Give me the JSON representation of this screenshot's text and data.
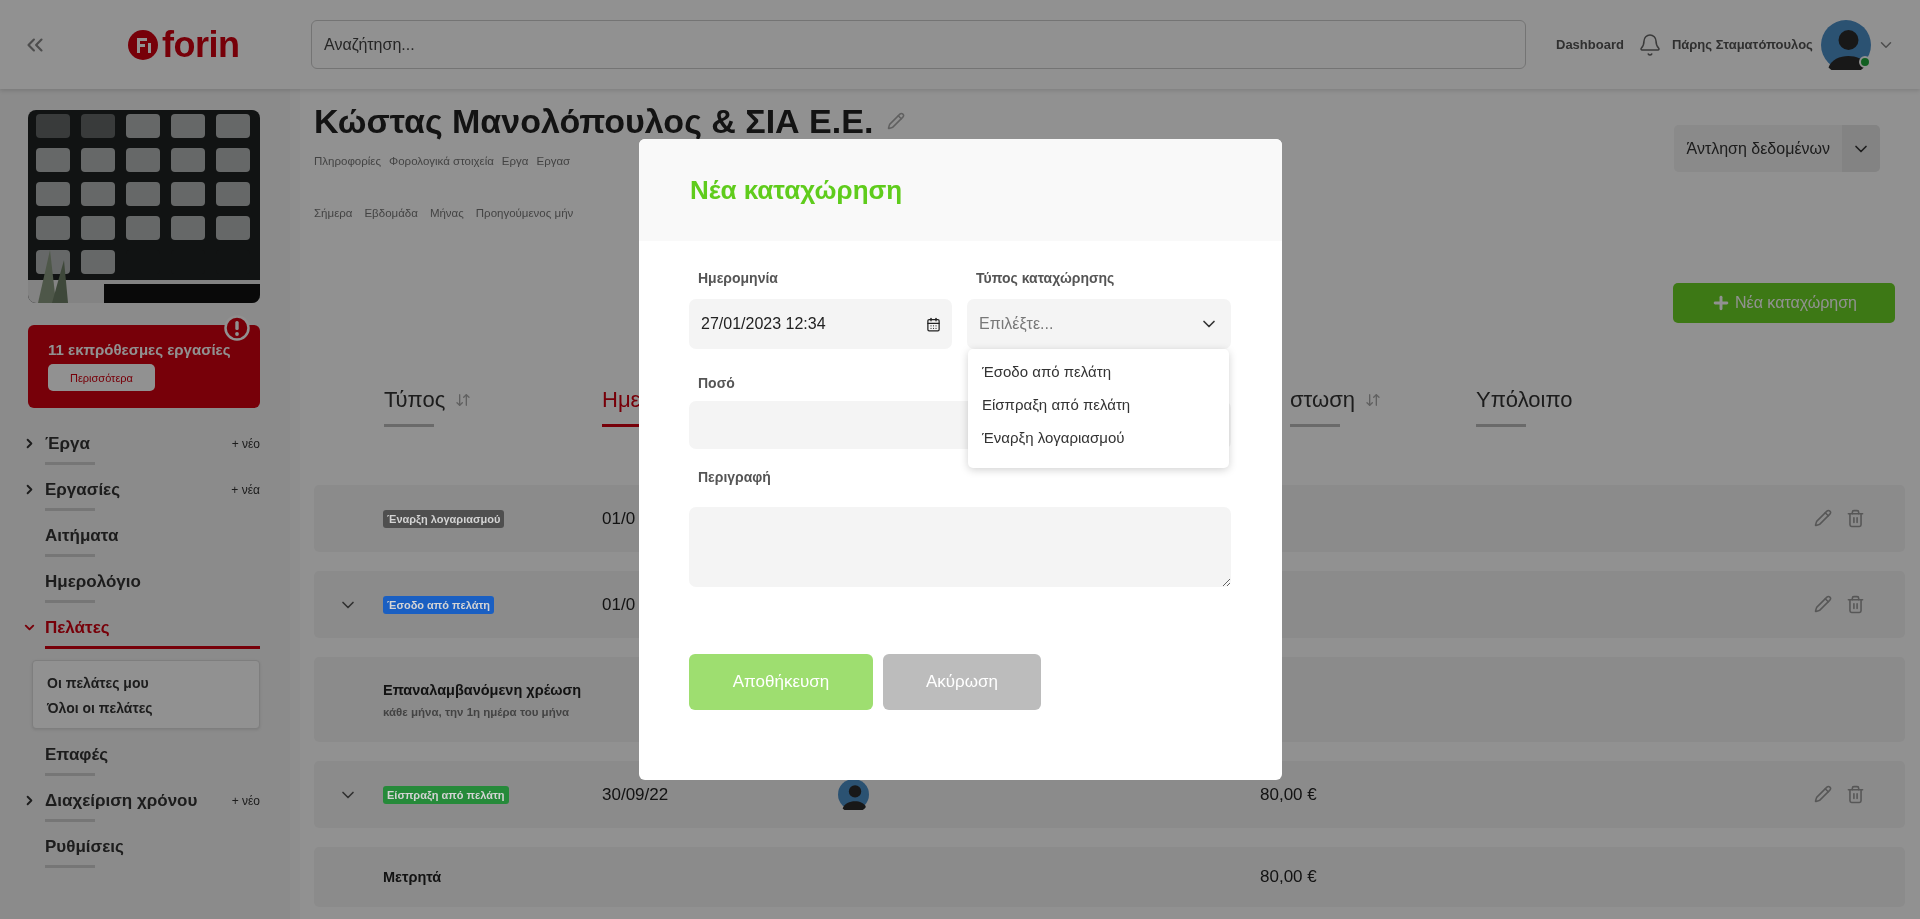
{
  "header": {
    "logo": "forin",
    "search": {
      "placeholder": "Αναζήτηση..."
    },
    "nav_link": "Dashboard",
    "user_name": "Πάρης Σταματόπουλος",
    "user_online": true
  },
  "sidebar": {
    "alert": {
      "text": "11 εκπρόθεσμες εργασίες",
      "button": "Περισσότερα"
    },
    "items": [
      {
        "kind": "group",
        "label": "Έργα",
        "expanded": false,
        "selected": false,
        "add_label": "+ νέο"
      },
      {
        "kind": "group",
        "label": "Εργασίες",
        "expanded": false,
        "selected": false,
        "add_label": "+ νέα"
      },
      {
        "kind": "link",
        "label": "Αιτήματα",
        "selected": false
      },
      {
        "kind": "link",
        "label": "Ημερολόγιο",
        "selected": false
      },
      {
        "kind": "group",
        "label": "Πελάτες",
        "expanded": true,
        "selected": true,
        "children": [
          {
            "label": "Οι πελάτες μου"
          },
          {
            "label": "Όλοι οι πελάτες"
          }
        ]
      },
      {
        "kind": "link",
        "label": "Επαφές",
        "selected": false
      },
      {
        "kind": "group",
        "label": "Διαχείριση χρόνου",
        "expanded": false,
        "selected": false,
        "add_label": "+ νέο"
      },
      {
        "kind": "link",
        "label": "Ρυθμίσεις",
        "selected": false
      }
    ]
  },
  "page": {
    "title": "Κώστας Μανολόπουλος & ΣΙΑ Ε.Ε.",
    "tabs": [
      "Πληροφορίες",
      "Φορολογικά στοιχεία",
      "Εργα",
      "Εργασ"
    ],
    "periods": [
      "Σήμερα",
      "Εβδομάδα",
      "Μήνας",
      "Προηγούμενος μήν"
    ],
    "export_button": "Άντληση δεδομένων",
    "new_button": "Νέα καταχώρηση",
    "columns": [
      {
        "label": "Τύπος",
        "sortable": true,
        "selected": false
      },
      {
        "label": "Ημε",
        "sortable": false,
        "selected": true
      },
      {
        "label": "στωση",
        "sortable": true,
        "selected": false
      },
      {
        "label": "Υπόλοιπο",
        "sortable": false,
        "selected": false
      }
    ],
    "rows": [
      {
        "kind": "entry",
        "expandable": false,
        "badge": {
          "label": "Έναρξη λογαριασμού",
          "color": "#4f4f4f"
        },
        "date": "01/0",
        "avatar": false
      },
      {
        "kind": "entry",
        "expandable": true,
        "badge": {
          "label": "Έσοδο από πελάτη",
          "color": "#1a5fc2"
        },
        "date": "01/0",
        "avatar": false
      },
      {
        "kind": "recurring",
        "title": "Επαναλαμβανόμενη χρέωση",
        "subtitle": "κάθε μήνα, την 1η ημέρα του μήνα"
      },
      {
        "kind": "entry",
        "expandable": true,
        "badge": {
          "label": "Είσπραξη από πελάτη",
          "color": "#268a3a"
        },
        "date": "30/09/22",
        "avatar": true,
        "amount": "80,00 €"
      },
      {
        "kind": "method",
        "title": "Μετρητά",
        "amount": "80,00 €"
      }
    ]
  },
  "modal": {
    "title": "Νέα καταχώρηση",
    "fields": [
      {
        "kind": "datetime",
        "label": "Ημερομηνία",
        "value": "27/01/2023 12:34"
      },
      {
        "kind": "select",
        "label": "Τύπος καταχώρησης",
        "placeholder": "Επιλέξτε...",
        "expanded": true,
        "options": [
          "Έσοδο από πελάτη",
          "Είσπραξη από πελάτη",
          "Έναρξη λογαριασμού"
        ]
      },
      {
        "kind": "text",
        "label": "Ποσό"
      },
      {
        "kind": "textarea",
        "label": "Περιγραφή"
      }
    ],
    "buttons": [
      {
        "kind": "primary",
        "label": "Αποθήκευση"
      },
      {
        "kind": "secondary",
        "label": "Ακύρωση"
      }
    ]
  }
}
